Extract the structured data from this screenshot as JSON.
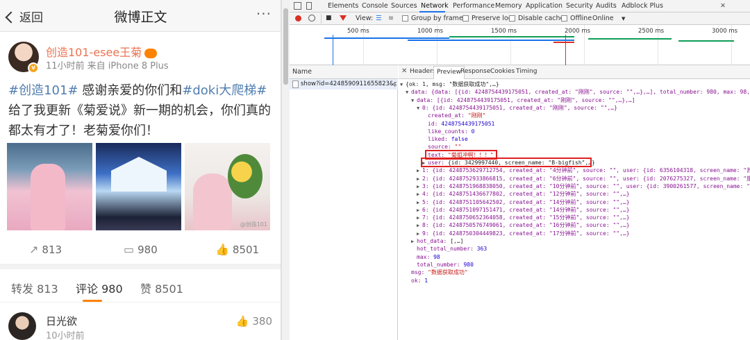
{
  "mobile": {
    "back_label": "返回",
    "title": "微博正文",
    "more_label": "···",
    "post": {
      "username": "创造101-esee王菊",
      "meta": "11小时前 来自 iPhone 8 Plus",
      "text_parts": {
        "t1": "#创造101#",
        "t2": " 感谢亲爱的你们和",
        "t3": "#doki大爬梯#",
        "t4": "给了我更新《菊爱说》新一期的机会，你们真的都太有才了！老菊爱你们！"
      },
      "photo_watermark": "@创造101",
      "repost_count": "813",
      "comment_count": "980",
      "like_count": "8501"
    },
    "tabs": {
      "repost": "转发 813",
      "comment": "评论 980",
      "like": "赞 8501"
    },
    "comment": {
      "name": "日光欲",
      "time": "10小时前",
      "likes": "380"
    }
  },
  "devtools": {
    "tabs": [
      "Elements",
      "Console",
      "Sources",
      "Network",
      "Performance",
      "Memory",
      "Application",
      "Security",
      "Audits",
      "Adblock Plus"
    ],
    "active_tab": "Network",
    "toolbar": {
      "view_label": "View:",
      "group_by_frame": "Group by frame",
      "preserve_log": "Preserve log",
      "disable_cache": "Disable cache",
      "offline": "Offline",
      "online": "Online"
    },
    "timeline_labels": [
      "500 ms",
      "1000 ms",
      "1500 ms",
      "2000 ms",
      "2500 ms",
      "3000 ms"
    ],
    "name_header": "Name",
    "request_name": "show?id=4248590911655823&pa...",
    "detail_tabs": [
      "Headers",
      "Preview",
      "Response",
      "Cookies",
      "Timing"
    ],
    "active_detail_tab": "Preview",
    "json_lines": {
      "l0": "{ok: 1, msg: \"数据获取成功\",…}",
      "l1": "data: {data: [{id: 4248754439175051, created_at: \"刚刚\", source: \"\",…},…], total_number: 980, max: 98,…}",
      "l2": "data: [{id: 4248754439175051, created_at: \"刚刚\", source: \"\",…},…]",
      "l3": "0: {id: 4248754439175051, created_at: \"刚刚\", source: \"\",…}",
      "l4_k": "created_at:",
      "l4_v": "\"刚刚\"",
      "l5_k": "id:",
      "l5_v": "4248754439175051",
      "l6_k": "like_counts:",
      "l6_v": "0",
      "l7_k": "liked:",
      "l7_v": "false",
      "l8_k": "source:",
      "l8_v": "\"\"",
      "l9_k": "text:",
      "l9_v": "\"菊姐冲啊！！！\"",
      "l10_k": "user:",
      "l10_v": "{id: 3429997440, screen_name: \"B-bigfish\",…}",
      "l11": "1: {id: 4248753629712754, created_at: \"4分钟前\", source: \"\", user: {id: 6356104318, screen_name: \"苏好\"",
      "l12": "2: {id: 4248752933866815, created_at: \"6分钟前\", source: \"\", user: {id: 2076275327, screen_name: \"旅途\"",
      "l13": "3: {id: 4248751968838050, created_at: \"10分钟前\", source: \"\", user: {id: 3900261577, screen_name: \"青泡\"",
      "l14": "4: {id: 4248751436677802, created_at: \"12分钟前\", source: \"\",…}",
      "l15": "5: {id: 4248751105642502, created_at: \"14分钟前\", source: \"\",…}",
      "l16": "6: {id: 4248751097151471, created_at: \"14分钟前\", source: \"\",…}",
      "l17": "7: {id: 4248750652364058, created_at: \"15分钟前\", source: \"\",…}",
      "l18": "8: {id: 4248750576749061, created_at: \"16分钟前\", source: \"\",…}",
      "l19": "9: {id: 4248750304449823, created_at: \"17分钟前\", source: \"\",…}",
      "l20_k": "hot_data:",
      "l20_v": "[,…]",
      "l21_k": "hot_total_number:",
      "l21_v": "363",
      "l22_k": "max:",
      "l22_v": "98",
      "l23_k": "total_number:",
      "l23_v": "980",
      "l24_k": "msg:",
      "l24_v": "\"数据获取成功\"",
      "l25_k": "ok:",
      "l25_v": "1"
    }
  },
  "colors": {
    "weibo_orange": "#ff8200",
    "username": "#eb7350",
    "link_blue": "#507daf",
    "highlight_red": "#e02020"
  }
}
